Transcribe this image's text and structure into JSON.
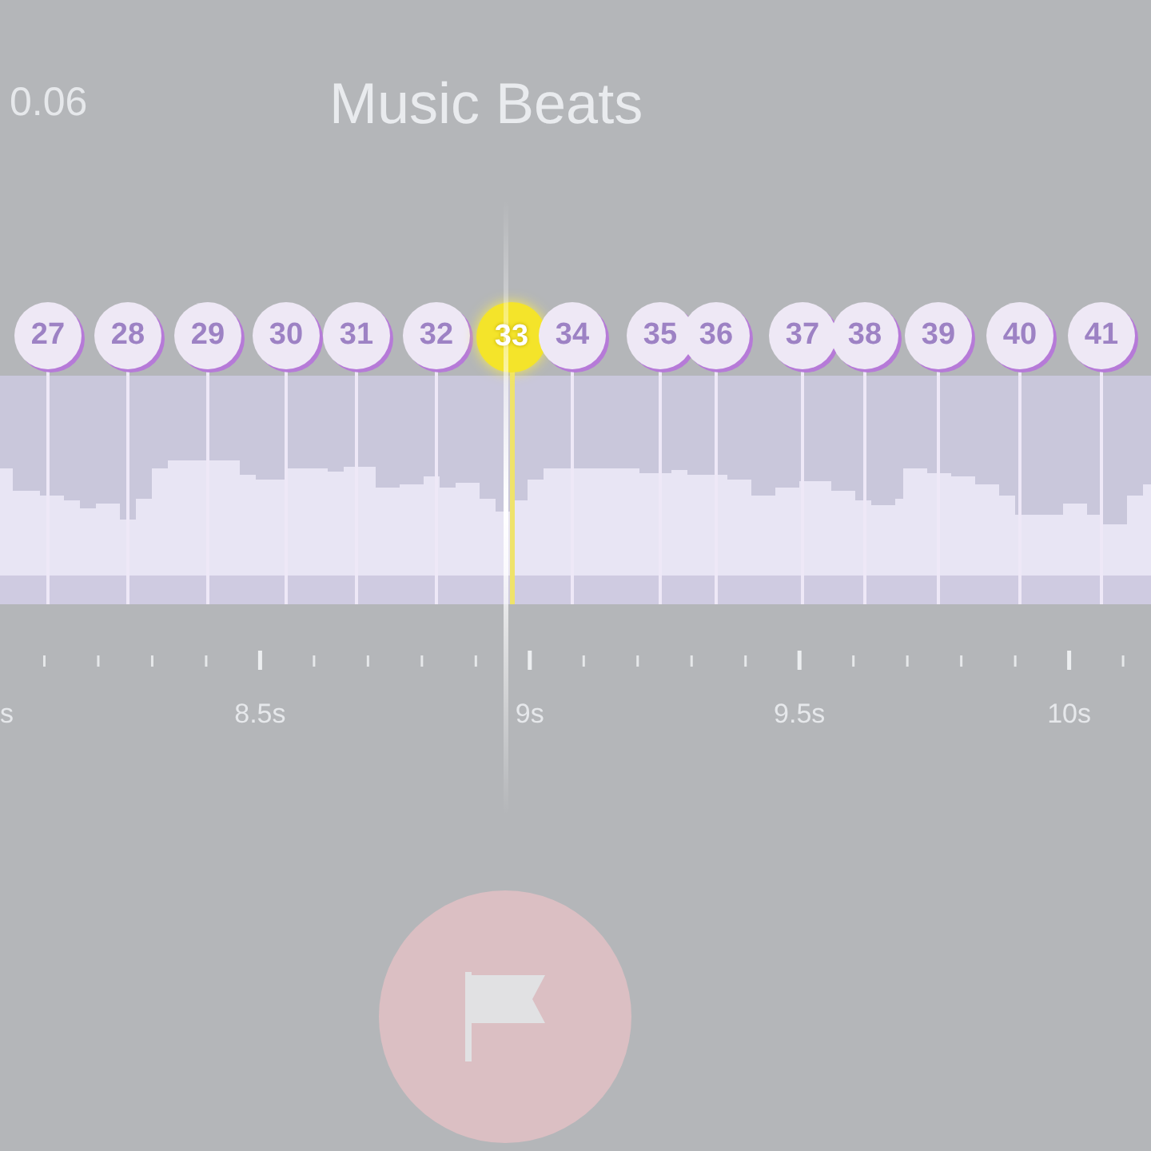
{
  "status": {
    "time": "0.06"
  },
  "title": "Music Beats",
  "beats": [
    {
      "label": "27",
      "selected": false
    },
    {
      "label": "28",
      "selected": false
    },
    {
      "label": "29",
      "selected": false
    },
    {
      "label": "30",
      "selected": false
    },
    {
      "label": "31",
      "selected": false
    },
    {
      "label": "32",
      "selected": false
    },
    {
      "label": "33",
      "selected": true
    },
    {
      "label": "34",
      "selected": false
    },
    {
      "label": "35",
      "selected": false
    },
    {
      "label": "36",
      "selected": false
    },
    {
      "label": "37",
      "selected": false
    },
    {
      "label": "38",
      "selected": false
    },
    {
      "label": "39",
      "selected": false
    },
    {
      "label": "40",
      "selected": false
    },
    {
      "label": "41",
      "selected": false
    }
  ],
  "time_axis": {
    "labels": [
      "s",
      "8.5s",
      "9s",
      "9.5s",
      "10s"
    ]
  }
}
